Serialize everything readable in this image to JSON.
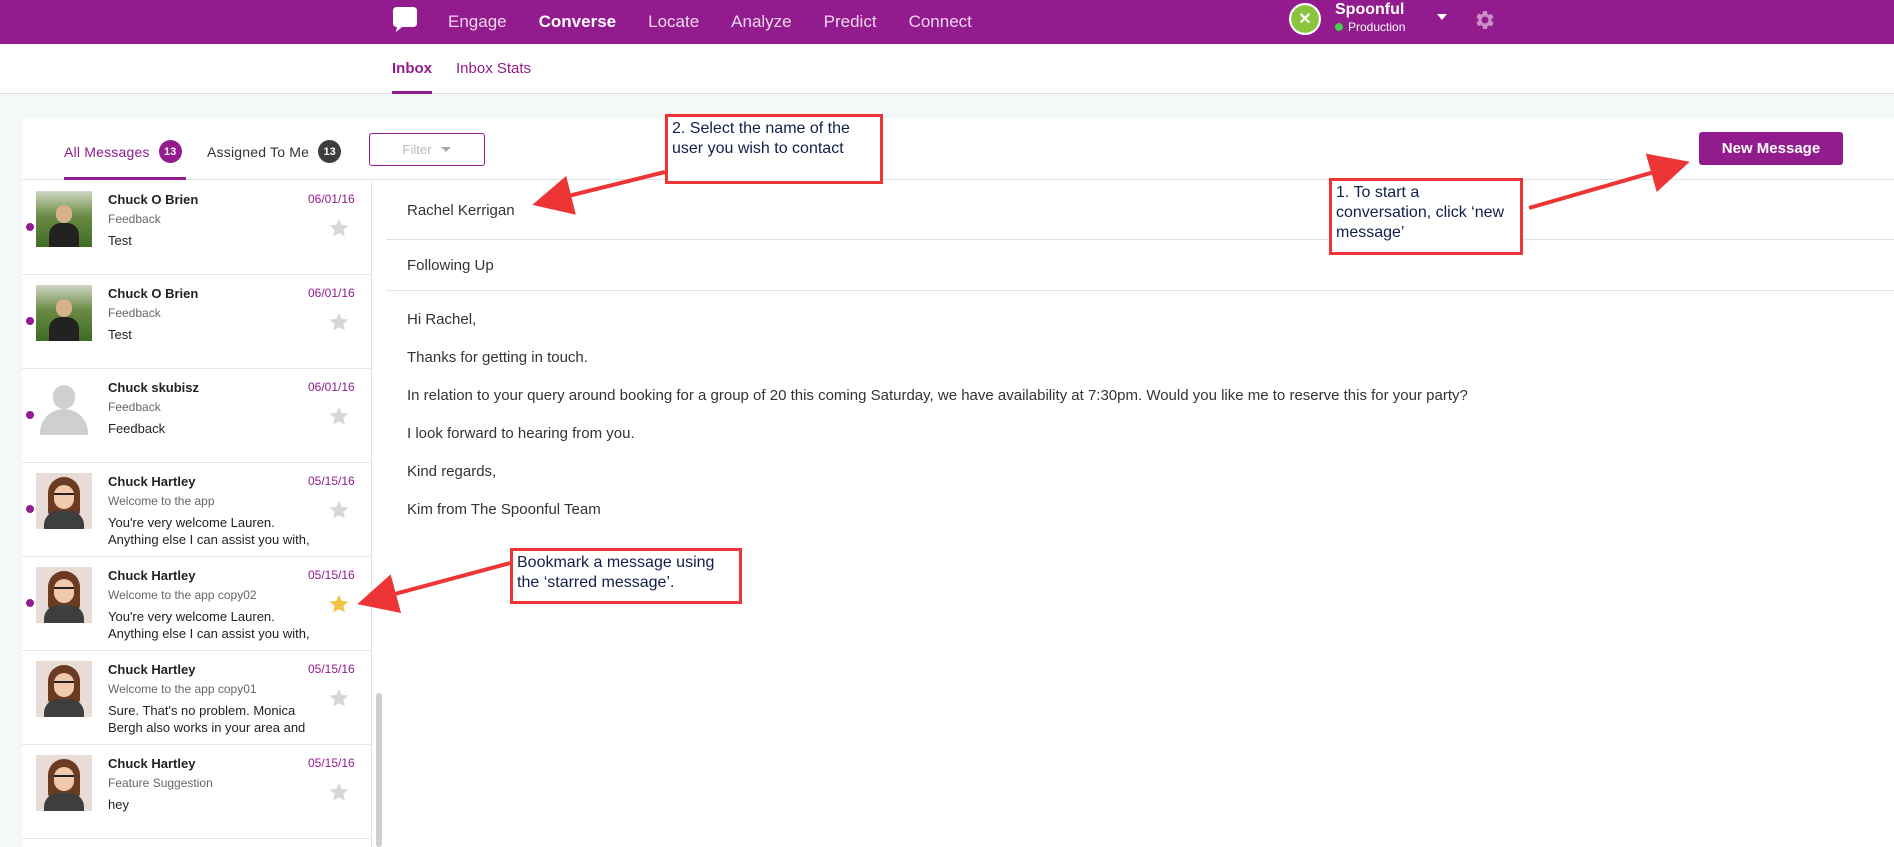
{
  "app": {
    "nav": [
      "Engage",
      "Converse",
      "Locate",
      "Analyze",
      "Predict",
      "Connect"
    ],
    "active_nav": "Converse",
    "account": {
      "name": "Spoonful",
      "environment": "Production"
    }
  },
  "subnav": {
    "tabs": [
      "Inbox",
      "Inbox Stats"
    ],
    "active": "Inbox"
  },
  "toolbar": {
    "all_messages": {
      "label": "All Messages",
      "count": "13"
    },
    "assigned_to_me": {
      "label": "Assigned To Me",
      "count": "13"
    },
    "filter_label": "Filter",
    "new_message_label": "New Message"
  },
  "messages": [
    {
      "name": "Chuck O Brien",
      "date": "06/01/16",
      "subject": "Feedback",
      "preview": "Test",
      "avatar": "stadium-photo",
      "starred": false,
      "unread": true
    },
    {
      "name": "Chuck O Brien",
      "date": "06/01/16",
      "subject": "Feedback",
      "preview": "Test",
      "avatar": "stadium-photo",
      "starred": false,
      "unread": true
    },
    {
      "name": "Chuck skubisz",
      "date": "06/01/16",
      "subject": "Feedback",
      "preview": "Feedback",
      "avatar": "default-user",
      "starred": false,
      "unread": true
    },
    {
      "name": "Chuck Hartley",
      "date": "05/15/16",
      "subject": "Welcome to the app",
      "preview": "You're very welcome Lauren. Anything else I can assist you with,",
      "avatar": "woman-photo",
      "starred": false,
      "unread": true
    },
    {
      "name": "Chuck Hartley",
      "date": "05/15/16",
      "subject": "Welcome to the app copy02",
      "preview": "You're very welcome Lauren. Anything else I can assist you with,",
      "avatar": "woman-photo",
      "starred": true,
      "unread": true
    },
    {
      "name": "Chuck Hartley",
      "date": "05/15/16",
      "subject": "Welcome to the app copy01",
      "preview": "Sure. That's no problem. Monica Bergh also works in your area and",
      "avatar": "woman-photo",
      "starred": false,
      "unread": false
    },
    {
      "name": "Chuck Hartley",
      "date": "05/15/16",
      "subject": "Feature Suggestion",
      "preview": "hey",
      "avatar": "woman-photo",
      "starred": false,
      "unread": false
    }
  ],
  "detail": {
    "recipient": "Rachel Kerrigan",
    "subject": "Following Up",
    "body": [
      "Hi Rachel,",
      "Thanks for getting in touch.",
      "In relation to your query around booking for a group of 20 this coming Saturday, we have availability at 7:30pm. Would you like me to reserve this for your party?",
      "I look forward to hearing from you.",
      "Kind regards,",
      "Kim from The Spoonful Team"
    ]
  },
  "annotations": {
    "select_user": "2. Select the name of the user you wish to contact",
    "start_conversation": "1. To start a conversation, click ‘new message’",
    "bookmark": "Bookmark a message using the ‘starred message’."
  },
  "colors": {
    "brand": "#921b8d",
    "annotation": "#ee3535",
    "star_active": "#f5c244",
    "star_inactive": "#d7d7d7"
  },
  "icons": {
    "logo": "speech-bubble-logo",
    "settings": "gear-icon",
    "star": "star-icon"
  }
}
